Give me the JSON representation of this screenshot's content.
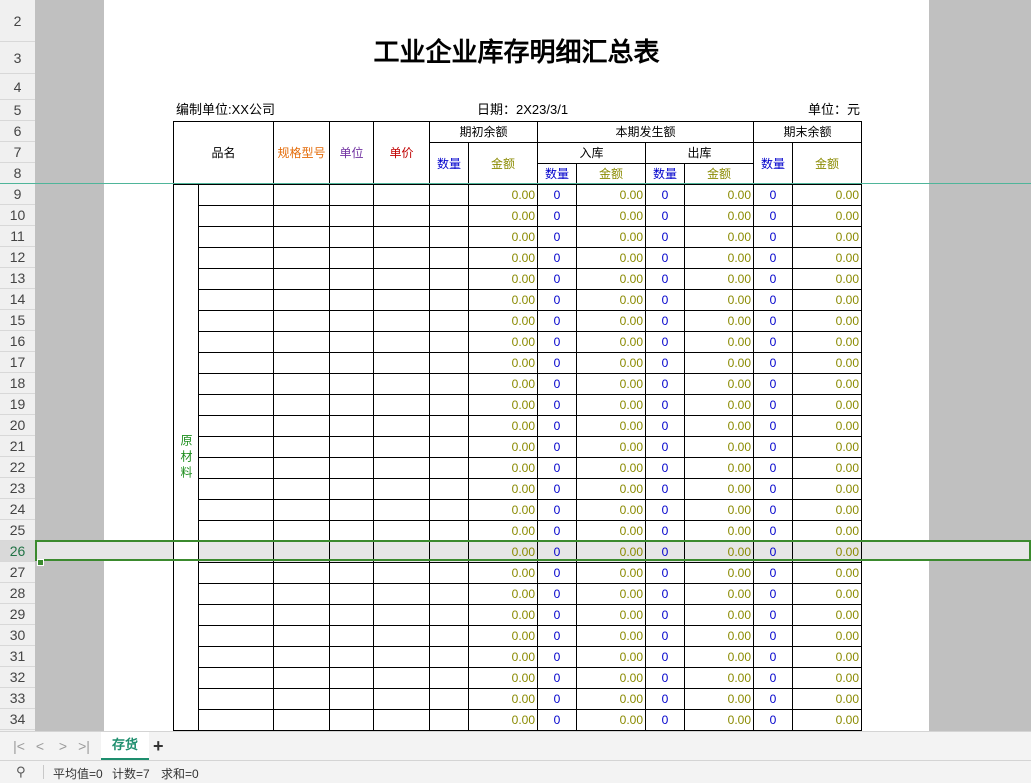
{
  "sheet": {
    "title": "工业企业库存明细汇总表",
    "company_label": "编制单位:XX公司",
    "date_label": "日期：2X23/3/1",
    "unit_label": "单位：元"
  },
  "row_numbers": [
    "2",
    "3",
    "4",
    "5",
    "6",
    "7",
    "8",
    "9",
    "10",
    "11",
    "12",
    "13",
    "14",
    "15",
    "16",
    "17",
    "18",
    "19",
    "20",
    "21",
    "22",
    "23",
    "24",
    "25",
    "26",
    "27",
    "28",
    "29",
    "30",
    "31",
    "32",
    "33",
    "34"
  ],
  "active_row": "26",
  "table": {
    "headers": {
      "name": "品名",
      "spec": "规格型号",
      "unit": "单位",
      "price": "单价",
      "opening": "期初余额",
      "current": "本期发生额",
      "inbound": "入库",
      "outbound": "出库",
      "closing": "期末余额",
      "qty": "数量",
      "amount": "金额"
    },
    "category_label": "原材料",
    "zero_qty": "0",
    "zero_amount": "0.00",
    "row_count": 26
  },
  "tabs": {
    "sheet_name": "存货",
    "add_label": "+"
  },
  "nav": {
    "first": "|<",
    "prev": "<",
    "next": ">",
    "last": ">|"
  },
  "status": {
    "icon": "pin-icon",
    "avg": "平均值=0",
    "count": "计数=7",
    "sum": "求和=0"
  },
  "colors": {
    "accent": "#1e8e6e",
    "selection": "#3b8a2e",
    "qty_blue": "#0000cc",
    "amount_olive": "#8a8a00",
    "category_green": "#1e8e1e"
  }
}
